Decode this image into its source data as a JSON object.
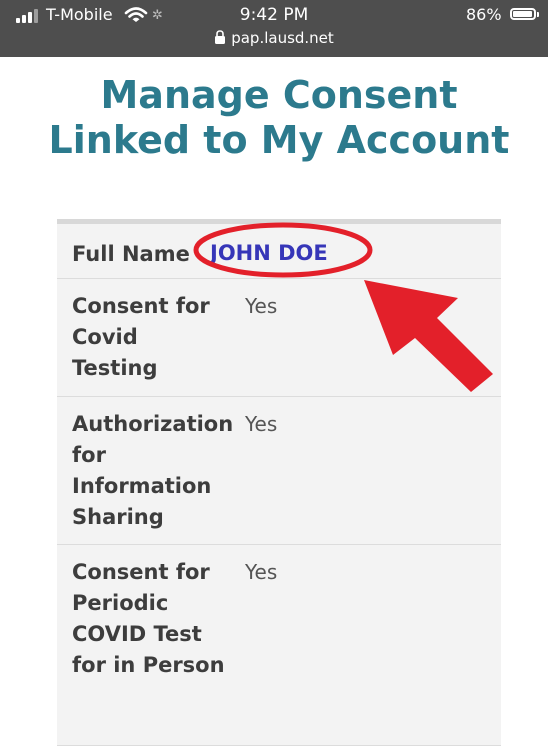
{
  "status_bar": {
    "carrier": "T-Mobile",
    "time": "9:42 PM",
    "battery": "86%",
    "url": "pap.lausd.net",
    "icons": [
      "signal-icon",
      "wifi-icon",
      "loading-spinner-icon",
      "battery-icon",
      "lock-icon"
    ]
  },
  "page": {
    "title": "Manage Consent Linked to My Account"
  },
  "table": {
    "rows": [
      {
        "label": "Full Name",
        "value": "JOHN DOE"
      },
      {
        "label": "Consent for Covid Testing",
        "value": "Yes"
      },
      {
        "label": "Authorization for Information Sharing",
        "value": "Yes"
      },
      {
        "label": "Consent for Periodic COVID Test for in Person",
        "value": "Yes"
      }
    ]
  },
  "colors": {
    "title": "#2c7a8d",
    "name_value": "#3636b8",
    "annotation": "#e3202a",
    "status_bar": "#4e4e4e"
  }
}
